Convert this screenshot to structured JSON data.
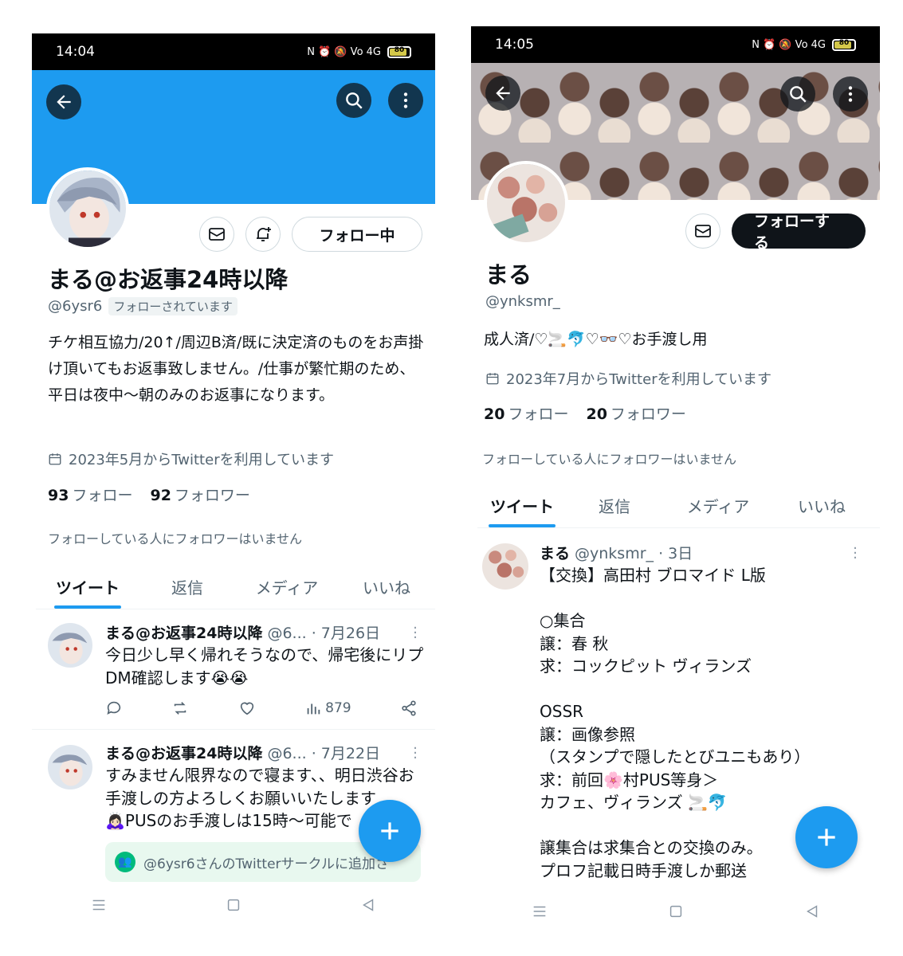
{
  "left": {
    "status": {
      "time": "14:04",
      "indicators": "N ⏰ 🔕 Vo 4G",
      "battery": "80"
    },
    "profile": {
      "name": "まる@お返事24時以降",
      "handle": "@6ysr6",
      "follows_you": "フォローされています",
      "bio": "チケ相互協力/20↑/周辺B済/既に決定済のものをお声掛け頂いてもお返事致しません。/仕事が繁忙期のため、平日は夜中〜朝のみのお返事になります。",
      "joined": "2023年5月からTwitterを利用しています",
      "following_count": "93",
      "following_label": "フォロー",
      "followers_count": "92",
      "followers_label": "フォロワー",
      "no_mutuals": "フォローしている人にフォロワーはいません",
      "follow_button": "フォロー中"
    },
    "tabs": [
      "ツイート",
      "返信",
      "メディア",
      "いいね"
    ],
    "tweets": [
      {
        "name": "まる@お返事24時以降",
        "meta": "@6... · 7月26日",
        "text": "今日少し早く帰れそうなので、帰宅後にリプDM確認します😭😭",
        "views": "879"
      },
      {
        "name": "まる@お返事24時以降",
        "meta": "@6... · 7月22日",
        "text": "すみません限界なので寝ます、、明日渋谷お手渡しの方よろしくお願いいたします🙇🏻‍♀️PUSのお手渡しは15時〜可能で",
        "circle_note": "@6ysr6さんのTwitterサークルに追加さ"
      }
    ]
  },
  "right": {
    "status": {
      "time": "14:05",
      "indicators": "N ⏰ 🔕 Vo 4G",
      "battery": "80"
    },
    "profile": {
      "name": "まる",
      "handle": "@ynksmr_",
      "bio": "成人済/♡🚬🐬♡👓♡お手渡し用",
      "joined": "2023年7月からTwitterを利用しています",
      "following_count": "20",
      "following_label": "フォロー",
      "followers_count": "20",
      "followers_label": "フォロワー",
      "no_mutuals": "フォローしている人にフォロワーはいません",
      "follow_button": "フォローする"
    },
    "tabs": [
      "ツイート",
      "返信",
      "メディア",
      "いいね"
    ],
    "tweet": {
      "name": "まる",
      "meta": "@ynksmr_ · 3日",
      "text": "【交換】高田村 ブロマイド L版\n\n○集合\n譲：春 秋\n求：コックピット ヴィランズ\n\nOSSR\n譲：画像参照\n（スタンプで隠したとびユニもあり）\n求：前回🌸村PUS等身＞\nカフェ、ヴィランズ 🚬🐬\n\n譲集合は求集合との交換のみ。\nプロフ記載日時手渡しか郵送"
    }
  },
  "colors": {
    "accent": "#1d9bf0",
    "text": "#0f1419",
    "muted": "#536471"
  },
  "icons": [
    "back-arrow-icon",
    "search-icon",
    "more-vert-icon",
    "mail-icon",
    "bell-plus-icon",
    "calendar-icon",
    "reply-icon",
    "retweet-icon",
    "heart-icon",
    "views-icon",
    "share-icon",
    "plus-icon",
    "circle-people-icon",
    "menu-icon",
    "home-square-icon",
    "back-triangle-icon"
  ]
}
